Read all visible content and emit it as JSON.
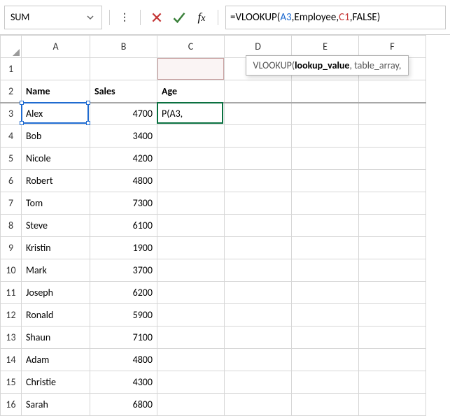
{
  "nameBox": "SUM",
  "formula": {
    "eq": "=VLOOKUP(",
    "ref1": "A3",
    "c1": ",Employee,",
    "ref2": "C1",
    "c2": ",FALSE)"
  },
  "tooltip": {
    "fn": "VLOOKUP(",
    "bold": "lookup_value",
    "rest": ", table_array, "
  },
  "columns": [
    "A",
    "B",
    "C",
    "D",
    "E",
    "F"
  ],
  "rowCount": 16,
  "headers": {
    "A": "Name",
    "B": "Sales",
    "C": "Age"
  },
  "editingCellDisplay": "P(A3,",
  "rows": [
    {
      "name": "Alex",
      "sales": "4700"
    },
    {
      "name": "Bob",
      "sales": "3400"
    },
    {
      "name": "Nicole",
      "sales": "4200"
    },
    {
      "name": "Robert",
      "sales": "4800"
    },
    {
      "name": "Tom",
      "sales": "7300"
    },
    {
      "name": "Steve",
      "sales": "6100"
    },
    {
      "name": "Kristin",
      "sales": "1900"
    },
    {
      "name": "Mark",
      "sales": "3700"
    },
    {
      "name": "Joseph",
      "sales": "6200"
    },
    {
      "name": "Ronald",
      "sales": "5900"
    },
    {
      "name": "Shaun",
      "sales": "7100"
    },
    {
      "name": "Adam",
      "sales": "4800"
    },
    {
      "name": "Christie",
      "sales": "4300"
    },
    {
      "name": "Sarah",
      "sales": "6800"
    }
  ]
}
